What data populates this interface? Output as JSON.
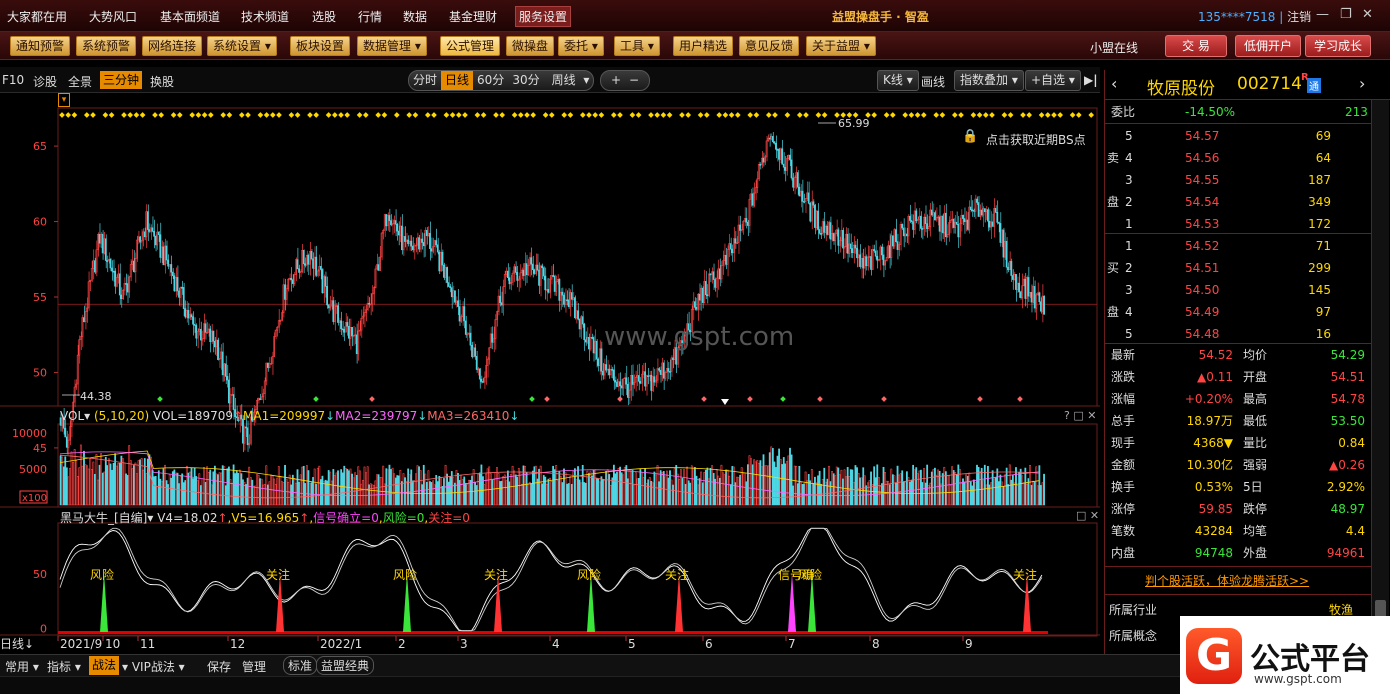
{
  "menubar": {
    "items": [
      "大家都在用",
      "大势风口",
      "基本面频道",
      "技术频道",
      "选股",
      "行情",
      "数据",
      "基金理财",
      "服务设置"
    ],
    "app_title": "益盟操盘手 · 智盈",
    "account": "135****7518",
    "logout": "注销"
  },
  "toolbar": {
    "buttons": [
      "通知预警",
      "系统预警",
      "网络连接",
      "系统设置",
      "板块设置",
      "数据管理",
      "公式管理",
      "微操盘",
      "委托",
      "工具",
      "用户精选",
      "意见反馈",
      "关于益盟"
    ],
    "online": "小盟在线",
    "trade": "交 易",
    "open_account": "低佣开户",
    "learn": "学习成长"
  },
  "subbar": {
    "left": [
      "F10",
      "诊股",
      "全景",
      "三分钟",
      "换股"
    ],
    "periods": [
      "分时",
      "日线",
      "60分",
      "30分",
      "周线"
    ],
    "right": [
      "K线",
      "画线",
      "指数叠加",
      "+自选"
    ]
  },
  "kchart": {
    "y_ticks": [
      "65",
      "60",
      "55",
      "50",
      "45"
    ],
    "max_label": "65.99",
    "min_label": "44.38",
    "bs_hint": "点击获取近期BS点",
    "watermark": "www.gspt.com"
  },
  "vol": {
    "label": "VOL",
    "params": "(5,10,20)",
    "vol": "VOL=189709",
    "ma1": "MA1=209997",
    "ma2": "MA2=239797",
    "ma3": "MA3=263410",
    "y_ticks": [
      "10000",
      "5000",
      "x100"
    ]
  },
  "indicator": {
    "name": "黑马大牛_[自编]",
    "v4": "V4=18.02",
    "v5": "V5=16.965",
    "sig": "信号确立=0",
    "risk": "风险=0",
    "focus": "关注=0",
    "y_ticks": [
      "50",
      "0"
    ],
    "labels": [
      "风险",
      "关注",
      "风险",
      "关注",
      "风险",
      "关注",
      "信号确",
      "风险",
      "关注"
    ]
  },
  "xaxis": {
    "left": "日线",
    "labels": [
      "2021/9",
      "10",
      "11",
      "12",
      "2022/1",
      "2",
      "3",
      "4",
      "5",
      "6",
      "7",
      "8",
      "9"
    ]
  },
  "quote": {
    "name": "牧原股份",
    "code": "002714",
    "weibi_label": "委比",
    "weibi": "-14.50%",
    "weicha": "213",
    "sell_label": [
      "卖",
      "盘"
    ],
    "buy_label": [
      "买",
      "盘"
    ],
    "sell": [
      [
        "5",
        "54.57",
        "69"
      ],
      [
        "4",
        "54.56",
        "64"
      ],
      [
        "3",
        "54.55",
        "187"
      ],
      [
        "2",
        "54.54",
        "349"
      ],
      [
        "1",
        "54.53",
        "172"
      ]
    ],
    "buy": [
      [
        "1",
        "54.52",
        "71"
      ],
      [
        "2",
        "54.51",
        "299"
      ],
      [
        "3",
        "54.50",
        "145"
      ],
      [
        "4",
        "54.49",
        "97"
      ],
      [
        "5",
        "54.48",
        "16"
      ]
    ],
    "stats": [
      [
        "最新",
        "54.52",
        "均价",
        "54.29"
      ],
      [
        "涨跌",
        "▲0.11",
        "开盘",
        "54.51"
      ],
      [
        "涨幅",
        "+0.20%",
        "最高",
        "54.78"
      ],
      [
        "总手",
        "18.97万",
        "最低",
        "53.50"
      ],
      [
        "现手",
        "4368▼",
        "量比",
        "0.84"
      ],
      [
        "金额",
        "10.30亿",
        "强弱",
        "▲0.26"
      ],
      [
        "换手",
        "0.53%",
        "5日",
        "2.92%"
      ],
      [
        "涨停",
        "59.85",
        "跌停",
        "48.97"
      ],
      [
        "笔数",
        "43284",
        "均笔",
        "4.4"
      ],
      [
        "内盘",
        "94748",
        "外盘",
        "94961"
      ]
    ],
    "promo": "判个股活跃，体验龙腾活跃>>",
    "industry_label": "所属行业",
    "industry": "牧渔",
    "concept_label": "所属概念"
  },
  "bottombar": {
    "items": [
      "常用",
      "指标",
      "战法",
      "VIP战法",
      "保存",
      "管理",
      "标准",
      "益盟经典"
    ]
  },
  "logo": {
    "text": "公式平台",
    "url": "www.gspt.com"
  },
  "colors": {
    "up": "#ff4444",
    "down": "#4dd8e6",
    "accent": "#e68a00",
    "brand": "#d94a4a"
  }
}
